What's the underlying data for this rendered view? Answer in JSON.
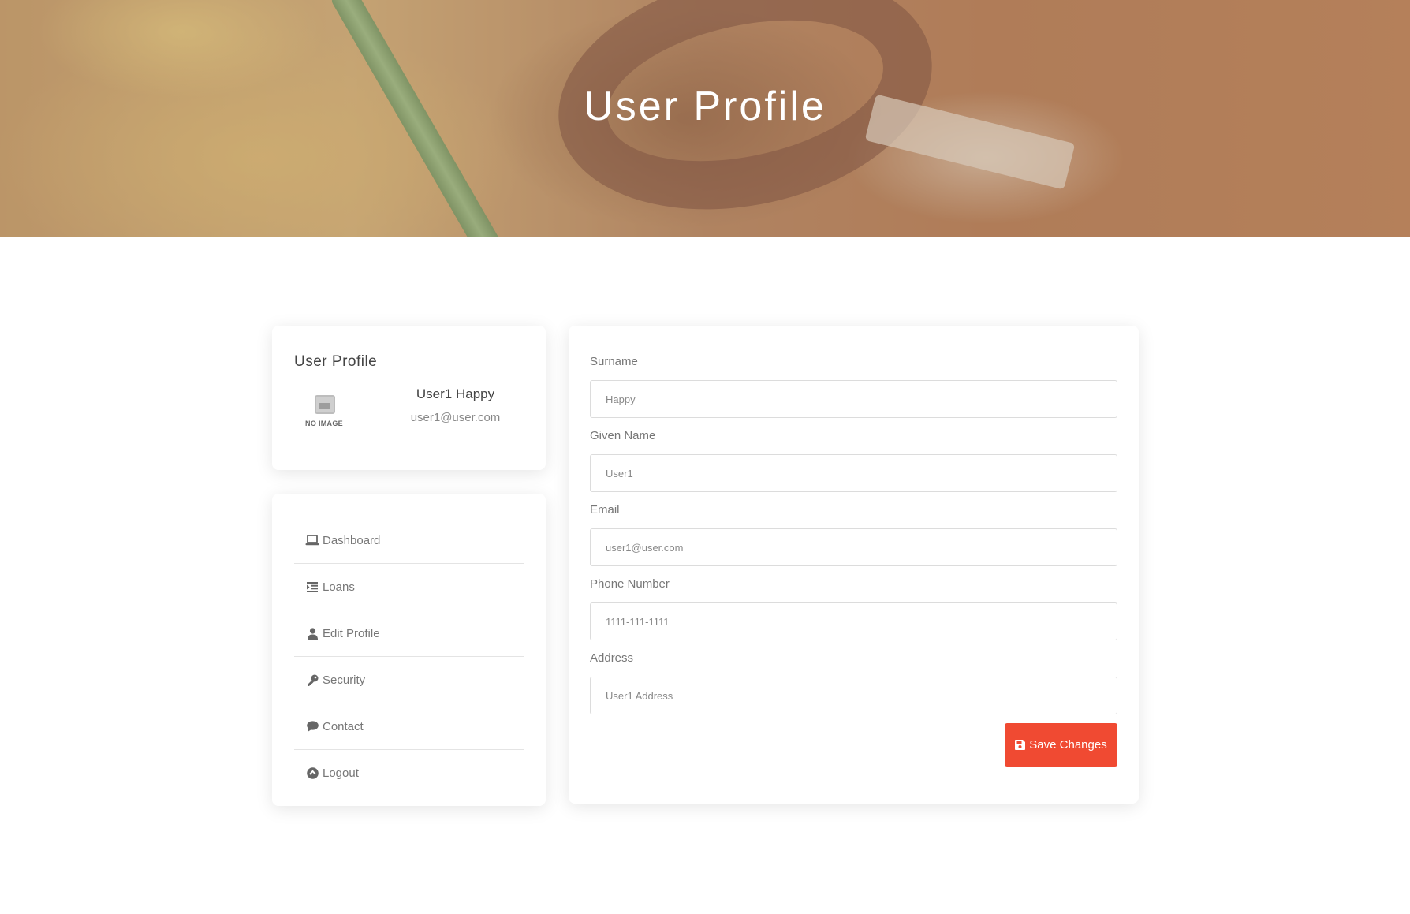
{
  "hero": {
    "title": "User Profile"
  },
  "profile": {
    "card_title": "User Profile",
    "avatar_text": "NO IMAGE",
    "name": "User1 Happy",
    "email": "user1@user.com"
  },
  "menu": {
    "items": [
      {
        "label": "Dashboard",
        "icon": "laptop-icon"
      },
      {
        "label": "Loans",
        "icon": "list-indent-icon"
      },
      {
        "label": "Edit Profile",
        "icon": "user-icon"
      },
      {
        "label": "Security",
        "icon": "key-icon"
      },
      {
        "label": "Contact",
        "icon": "comment-icon"
      },
      {
        "label": "Logout",
        "icon": "arrow-circle-up-icon"
      }
    ]
  },
  "form": {
    "surname": {
      "label": "Surname",
      "value": "Happy"
    },
    "given_name": {
      "label": "Given Name",
      "value": "User1"
    },
    "email": {
      "label": "Email",
      "value": "user1@user.com"
    },
    "phone": {
      "label": "Phone Number",
      "value": "1111-111-1111"
    },
    "address": {
      "label": "Address",
      "value": "User1 Address"
    },
    "save_label": "Save Changes"
  },
  "colors": {
    "accent": "#f04a32",
    "hero_overlay": "#a08264"
  }
}
